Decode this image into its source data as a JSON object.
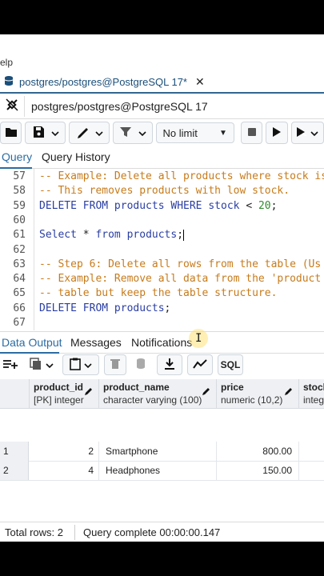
{
  "menu": {
    "partial_label": "elp"
  },
  "query_tab": {
    "title": "postgres/postgres@PostgreSQL 17*",
    "close": "✕"
  },
  "connection": {
    "name": "postgres/postgres@PostgreSQL 17"
  },
  "toolbar": {
    "limit_label": "No limit",
    "limit_arrow": "▼"
  },
  "editor_tabs": {
    "query": "Query",
    "history": "Query History"
  },
  "editor": {
    "lines": [
      {
        "no": "57",
        "segments": [
          [
            "cm",
            "-- Example: Delete all products where stock is"
          ]
        ]
      },
      {
        "no": "58",
        "segments": [
          [
            "cm",
            "-- This removes products with low stock."
          ]
        ]
      },
      {
        "no": "59",
        "segments": [
          [
            "kw",
            "DELETE FROM "
          ],
          [
            "id",
            "products "
          ],
          [
            "kw",
            "WHERE "
          ],
          [
            "id",
            "stock "
          ],
          [
            "op",
            "< "
          ],
          [
            "num",
            "20"
          ],
          [
            "op",
            ";"
          ]
        ]
      },
      {
        "no": "60",
        "segments": []
      },
      {
        "no": "61",
        "segments": [
          [
            "kw",
            "Select "
          ],
          [
            "op",
            "* "
          ],
          [
            "kw",
            "from "
          ],
          [
            "id",
            "products"
          ],
          [
            "op",
            ";"
          ]
        ],
        "cursor": true
      },
      {
        "no": "62",
        "segments": []
      },
      {
        "no": "63",
        "segments": [
          [
            "cm",
            "-- Step 6: Delete all rows from the table (Us"
          ]
        ]
      },
      {
        "no": "64",
        "segments": [
          [
            "cm",
            "-- Example: Remove all data from the 'product"
          ]
        ]
      },
      {
        "no": "65",
        "segments": [
          [
            "cm",
            "-- table but keep the table structure."
          ]
        ]
      },
      {
        "no": "66",
        "segments": [
          [
            "kw",
            "DELETE FROM "
          ],
          [
            "id",
            "products"
          ],
          [
            "op",
            ";"
          ]
        ]
      },
      {
        "no": "67",
        "segments": []
      }
    ]
  },
  "results_tabs": {
    "data_output": "Data Output",
    "messages": "Messages",
    "notifications": "Notifications"
  },
  "grid_toolbar": {
    "sql_label": "SQL"
  },
  "columns": [
    {
      "name": "product_id",
      "type": "[PK] integer"
    },
    {
      "name": "product_name",
      "type": "character varying (100)"
    },
    {
      "name": "price",
      "type": "numeric (10,2)"
    },
    {
      "name": "stock",
      "type": "integ"
    }
  ],
  "rows": [
    {
      "n": "1",
      "product_id": "2",
      "product_name": "Smartphone",
      "price": "800.00"
    },
    {
      "n": "2",
      "product_id": "4",
      "product_name": "Headphones",
      "price": "150.00"
    }
  ],
  "status": {
    "total_rows": "Total rows: 2",
    "query_complete": "Query complete 00:00:00.147"
  },
  "colors": {
    "accent": "#2c6ca3",
    "comment": "#c77b1b",
    "keyword": "#2a3ea3",
    "number": "#2f8a2f"
  }
}
